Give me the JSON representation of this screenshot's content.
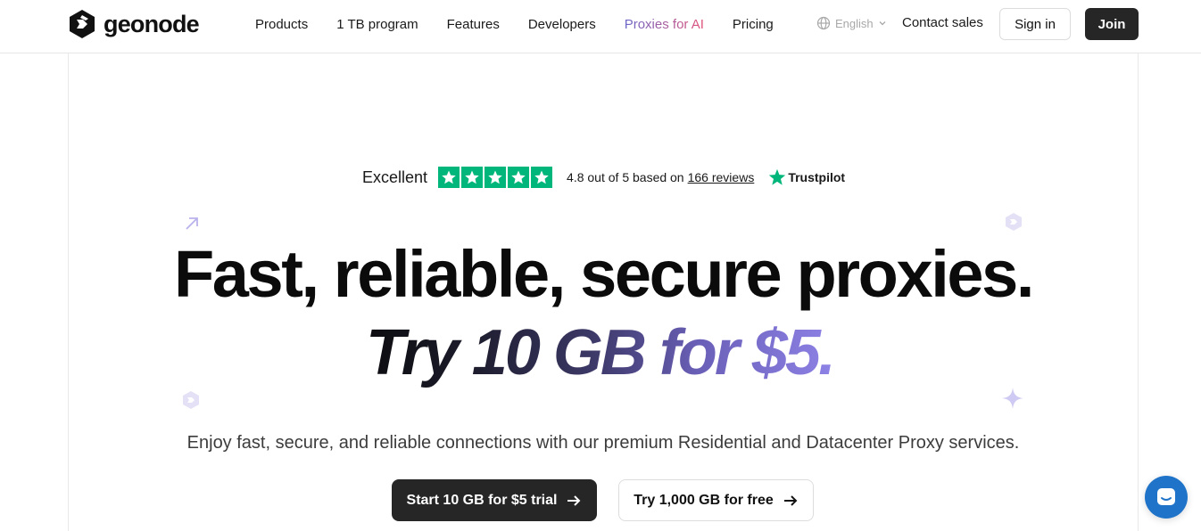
{
  "header": {
    "logo_text": "geonode",
    "nav": [
      {
        "label": "Products"
      },
      {
        "label": "1 TB program"
      },
      {
        "label": "Features"
      },
      {
        "label": "Developers"
      },
      {
        "label": "Proxies for AI"
      },
      {
        "label": "Pricing"
      }
    ],
    "language": "English",
    "contact_label": "Contact sales",
    "signin_label": "Sign in",
    "join_label": "Join"
  },
  "trustpilot": {
    "rating_word": "Excellent",
    "stars": 5,
    "score_text": "4.8 out of 5 based on",
    "reviews_link": "166 reviews",
    "brand": "Trustpilot",
    "star_color": "#00b67a"
  },
  "hero": {
    "headline": "Fast, reliable, secure proxies.",
    "offer": "Try 10 GB for $5.",
    "subtitle": "Enjoy fast, secure, and reliable connections with our premium Residential and Datacenter Proxy services.",
    "cta_primary": "Start 10 GB for $5 trial",
    "cta_secondary": "Try 1,000 GB for free"
  },
  "colors": {
    "dark": "#262626",
    "accent_purple": "#8f84e8",
    "chat_blue": "#1f74c9"
  }
}
